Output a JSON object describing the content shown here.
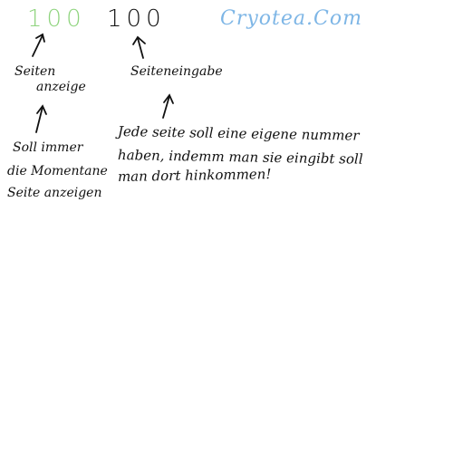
{
  "left_counter": {
    "value": "100",
    "color": "#8fd47e"
  },
  "right_counter": {
    "value": "100"
  },
  "brand": {
    "text": "Cryotea.Com",
    "color": "#7eb6e6"
  },
  "labels": {
    "page_display_line1": "Seiten",
    "page_display_line2": "anzeige",
    "page_input": "Seiteneingabe"
  },
  "notes": {
    "left_line1": "Soll immer",
    "left_line2": "die Momentane",
    "left_line3": "Seite anzeigen",
    "right_line1": "Jede seite soll eine eigene nummer",
    "right_line2": "haben, indemm man sie eingibt soll",
    "right_line3": "man dort hinkommen!"
  },
  "ink_color": "#111111"
}
